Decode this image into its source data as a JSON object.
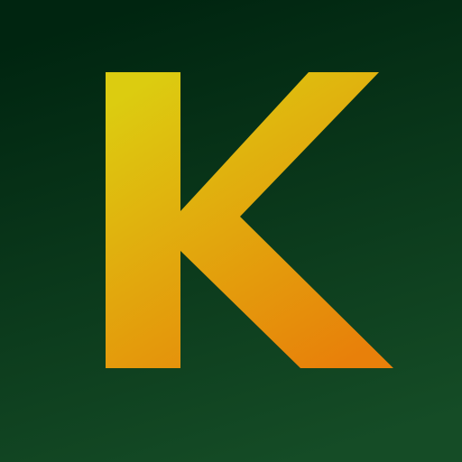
{
  "logo": {
    "letter": "K",
    "colors": {
      "background_top": "#002510",
      "background_bottom": "#154c26",
      "letter_top": "#dccc10",
      "letter_bottom": "#e8800a"
    }
  }
}
